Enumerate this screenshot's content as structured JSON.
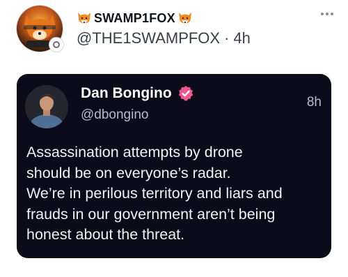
{
  "post": {
    "display_name": "SWAMP1FOX",
    "handle": "@THE1SWAMPFOX",
    "separator": "·",
    "time": "4h",
    "avatar_icon": "fox-mascot-avatar",
    "name_prefix_icon": "fox-face-icon",
    "name_suffix_icon": "fox-face-icon",
    "more_icon": "more-dots-icon"
  },
  "quoted_post": {
    "author_name": "Dan Bongino",
    "handle": "@dbongino",
    "time": "8h",
    "verified_icon": "verified-badge-icon",
    "verified_color": "#f0568e",
    "background_color": "#0b0b1a",
    "text_lines": [
      "Assassination attempts by drone",
      "should be on everyone’s radar.",
      "We’re in perilous territory and liars and",
      "frauds in our government aren’t being",
      "honest about the threat."
    ]
  },
  "colors": {
    "fox_orange": "#f28a1e",
    "text_dark": "#0f1419",
    "text_muted": "#3a3f45"
  }
}
